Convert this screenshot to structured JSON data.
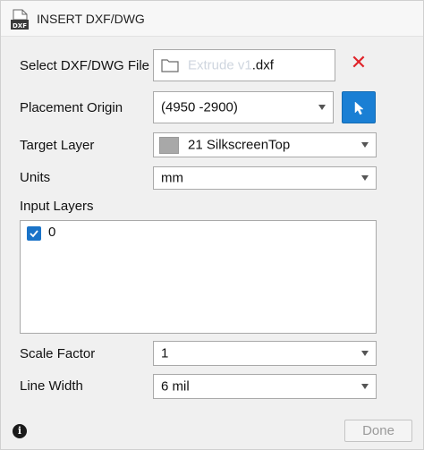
{
  "window": {
    "title": "INSERT DXF/DWG",
    "icon": "dxf-file-icon"
  },
  "form": {
    "select_file": {
      "label": "Select DXF/DWG File",
      "value_prefix": "Extrude v1",
      "value_suffix": ".dxf",
      "folder_icon": "folder-icon",
      "clear_icon": "close-x-icon",
      "clear_color": "#e0242a"
    },
    "placement_origin": {
      "label": "Placement Origin",
      "value": "(4950 -2900)",
      "pick_icon": "cursor-pick-icon",
      "pick_color": "#1a7fd4"
    },
    "target_layer": {
      "label": "Target Layer",
      "value": "21 SilkscreenTop",
      "swatch_color": "#a8a8a8"
    },
    "units": {
      "label": "Units",
      "value": "mm"
    },
    "input_layers": {
      "label": "Input Layers",
      "items": [
        {
          "label": "0",
          "checked": true
        }
      ]
    },
    "scale_factor": {
      "label": "Scale Factor",
      "value": "1"
    },
    "line_width": {
      "label": "Line Width",
      "value": "6 mil"
    }
  },
  "footer": {
    "info_icon": "info-icon",
    "done_label": "Done"
  }
}
